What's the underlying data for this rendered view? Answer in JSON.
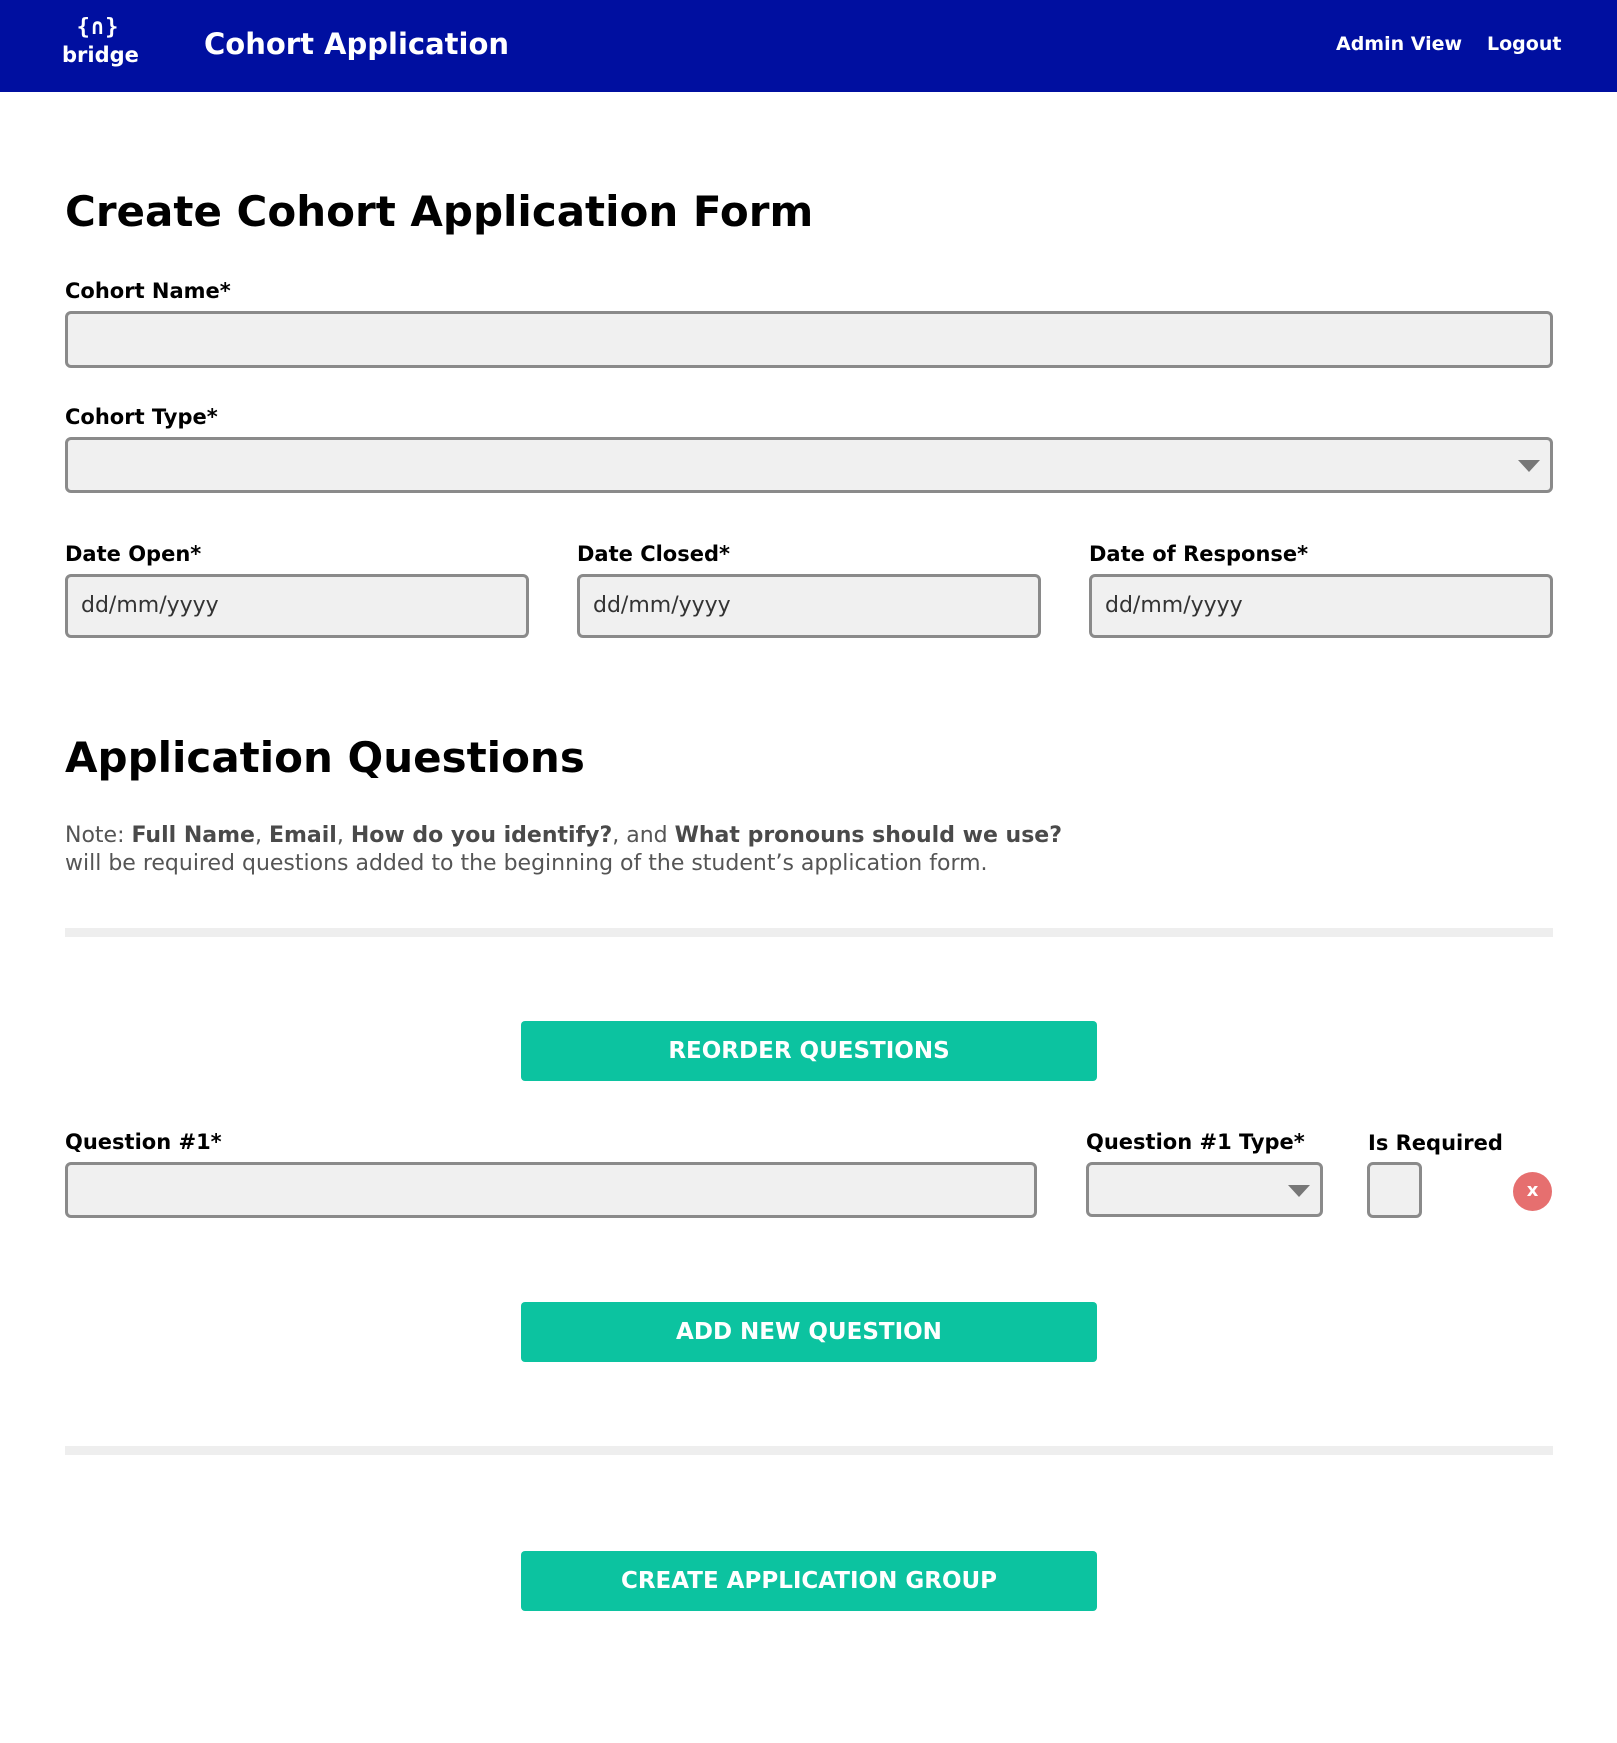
{
  "header": {
    "logo_mark": "{∩}",
    "logo_text": "bridge",
    "title": "Cohort Application",
    "nav": {
      "admin_view": "Admin View",
      "logout": "Logout"
    }
  },
  "form": {
    "heading": "Create Cohort Application Form",
    "cohort_name": {
      "label": "Cohort Name*",
      "value": ""
    },
    "cohort_type": {
      "label": "Cohort Type*",
      "value": ""
    },
    "date_open": {
      "label": "Date Open*",
      "placeholder": "dd/mm/yyyy"
    },
    "date_closed": {
      "label": "Date Closed*",
      "placeholder": "dd/mm/yyyy"
    },
    "date_response": {
      "label": "Date of Response*",
      "placeholder": "dd/mm/yyyy"
    }
  },
  "questions_section": {
    "heading": "Application Questions",
    "note": {
      "prefix": "Note: ",
      "full_name": "Full Name",
      "sep1": ", ",
      "email": "Email",
      "sep2": ", ",
      "identify": "How do you identify?",
      "sep3": ", and ",
      "pronouns": "What pronouns should we use?",
      "suffix": "will be required questions added to the beginning of the student’s application form."
    },
    "reorder_button": "REORDER QUESTIONS",
    "question_1": {
      "label": "Question #1*",
      "type_label": "Question #1 Type*",
      "required_label": "Is Required",
      "remove_glyph": "x"
    },
    "add_button": "ADD NEW QUESTION"
  },
  "submit_button": "CREATE APPLICATION GROUP",
  "colors": {
    "header_bg": "#000fa0",
    "button_bg": "#0cc3a0",
    "remove_bg": "#e66f6f",
    "field_bg": "#f0f0f0"
  }
}
